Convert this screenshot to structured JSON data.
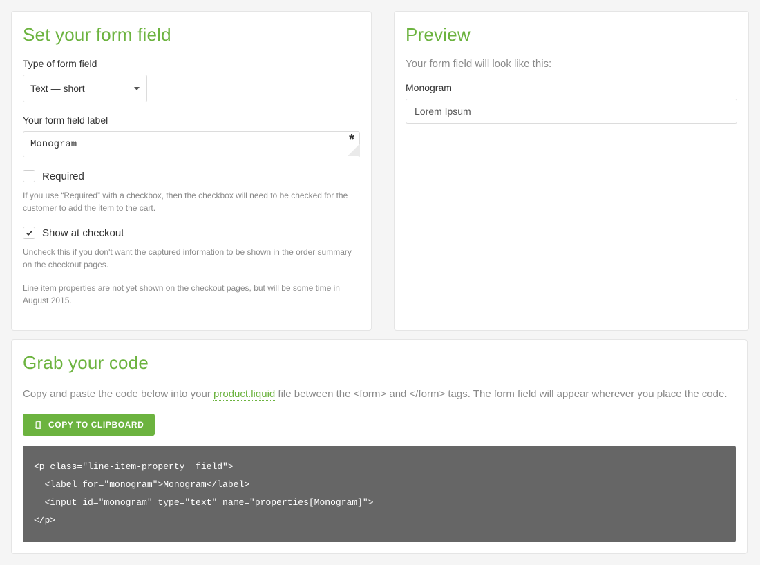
{
  "left": {
    "title": "Set your form field",
    "type_label": "Type of form field",
    "type_value": "Text — short",
    "field_label_label": "Your form field label",
    "field_label_value": "Monogram",
    "required_label": "Required",
    "required_help": "If you use “Required” with a checkbox, then the checkbox will need to be checked for the customer to add the item to the cart.",
    "show_label": "Show at checkout",
    "show_help": "Uncheck this if you don't want the captured information to be shown in the order summary on the checkout pages.",
    "note": "Line item properties are not yet shown on the checkout pages, but will be some time in August 2015."
  },
  "right": {
    "title": "Preview",
    "subtitle": "Your form field will look like this:",
    "label": "Monogram",
    "input_value": "Lorem Ipsum"
  },
  "code": {
    "title": "Grab your code",
    "desc_before": "Copy and paste the code below into your ",
    "link_text": "product.liquid",
    "desc_after": " file between the <form> and </form> tags. The form field will appear wherever you place the code.",
    "button": "COPY TO CLIPBOARD",
    "snippet": "<p class=\"line-item-property__field\">\n  <label for=\"monogram\">Monogram</label>\n  <input id=\"monogram\" type=\"text\" name=\"properties[Monogram]\">\n</p>"
  }
}
